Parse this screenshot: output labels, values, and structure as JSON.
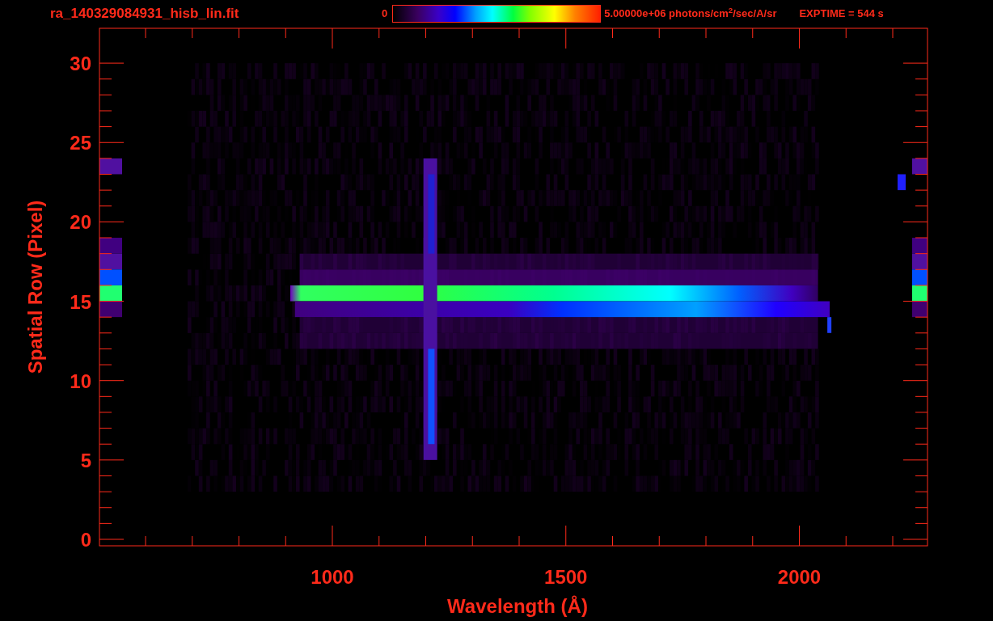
{
  "title": "ra_140329084931_hisb_lin.fit",
  "colorbar": {
    "min_label": "0",
    "max_label": "5.00000e+06 photons/cm$^{2}$/sec/A/sr"
  },
  "exposure": "EXPTIME = 544 s",
  "y_axis": {
    "title": "Spatial Row (Pixel)",
    "ticks": [
      "30",
      "25",
      "20",
      "15",
      "10",
      "5",
      "0"
    ]
  },
  "x_axis": {
    "title": "Wavelength (Å)",
    "ticks": [
      "1000",
      "1500",
      "2000"
    ]
  }
}
